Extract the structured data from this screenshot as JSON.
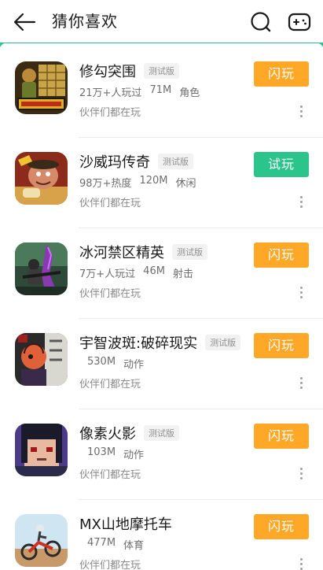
{
  "header": {
    "title": "猜你喜欢",
    "back_icon": "arrow-left-icon",
    "search_icon": "search-icon",
    "game_icon": "gamepad-icon"
  },
  "colors": {
    "play_orange": "#ffa726",
    "play_green": "#2bc48a",
    "accent": "#2bc48a"
  },
  "games": [
    {
      "name": "修勾突围",
      "tag": "测试版",
      "meta": [
        "21万+人玩过",
        "71M",
        "角色"
      ],
      "subtitle": "伙伴们都在玩",
      "button": "闪玩",
      "button_style": "orange"
    },
    {
      "name": "沙威玛传奇",
      "tag": "测试版",
      "meta": [
        "98万+热度",
        "120M",
        "休闲"
      ],
      "subtitle": "伙伴们都在玩",
      "button": "试玩",
      "button_style": "green"
    },
    {
      "name": "冰河禁区精英",
      "tag": "测试版",
      "meta": [
        "7万+人玩过",
        "46M",
        "射击"
      ],
      "subtitle": "伙伴们都在玩",
      "button": "闪玩",
      "button_style": "orange"
    },
    {
      "name": "宇智波斑:破碎现实",
      "tag": "测试版",
      "meta": [
        "530M",
        "动作"
      ],
      "subtitle": "伙伴们都在玩",
      "button": "闪玩",
      "button_style": "orange"
    },
    {
      "name": "像素火影",
      "tag": "测试版",
      "meta": [
        "103M",
        "动作"
      ],
      "subtitle": "伙伴们都在玩",
      "button": "闪玩",
      "button_style": "orange"
    },
    {
      "name": "MX山地摩托车",
      "tag": "",
      "meta": [
        "477M",
        "体育"
      ],
      "subtitle": "伙伴们都在玩",
      "button": "闪玩",
      "button_style": "orange"
    }
  ]
}
